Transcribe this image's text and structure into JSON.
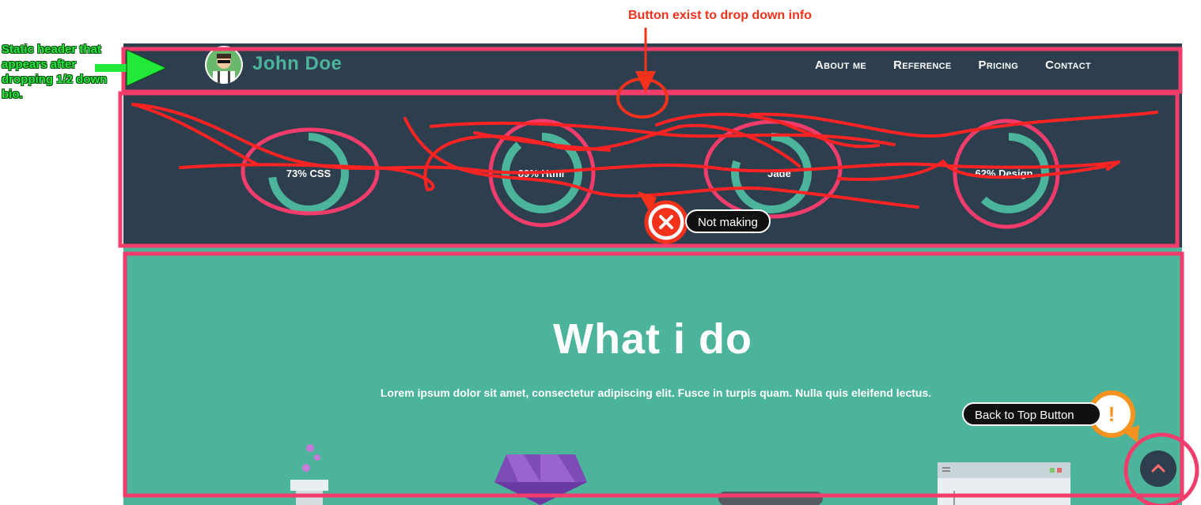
{
  "site": {
    "brand": "John Doe",
    "nav": [
      "About me",
      "Reference",
      "Pricing",
      "Contact"
    ],
    "skills": [
      {
        "label": "73% CSS",
        "percent": 73
      },
      {
        "label": "89% Html",
        "percent": 89
      },
      {
        "label": "Jade",
        "percent": 80
      },
      {
        "label": "62% Design",
        "percent": 62
      }
    ],
    "what_i_do": {
      "title": "What i do",
      "text": "Lorem ipsum dolor sit amet, consectetur adipiscing elit. Fusce in turpis quam. Nulla quis eleifend lectus."
    },
    "back_to_top_icon": "chevron-up-icon"
  },
  "annotations": {
    "header_note": "Static header that appears after dropping 1/2 down bio.",
    "dropdown_note": "Button exist to drop down info",
    "not_making": "Not making",
    "back_to_top": "Back to Top Button"
  },
  "colors": {
    "dark": "#2d3e4f",
    "teal": "#4bb49a",
    "annotation_pink": "#f23d6c",
    "annotation_red": "#f4321c",
    "annotation_green": "#22e83a"
  }
}
